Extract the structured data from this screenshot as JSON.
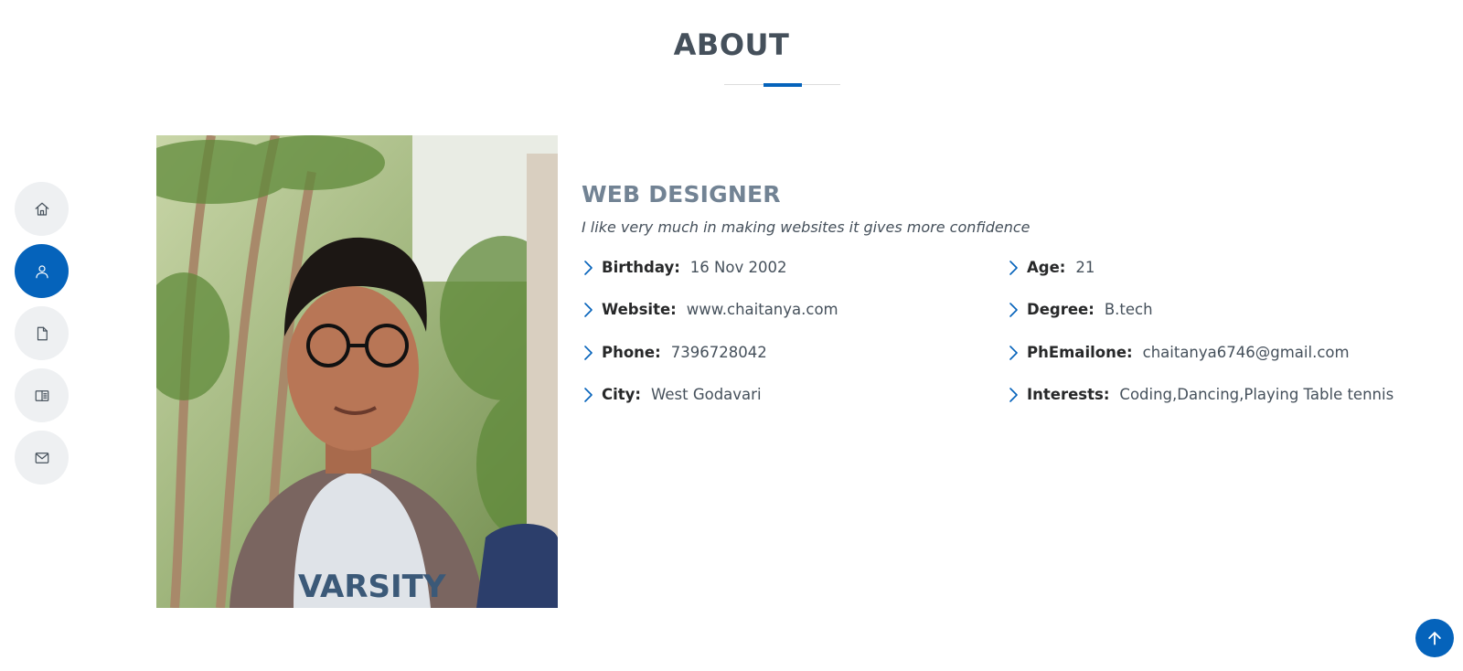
{
  "nav": {
    "items": [
      {
        "icon": "home-icon",
        "active": false
      },
      {
        "icon": "person-icon",
        "active": true
      },
      {
        "icon": "file-icon",
        "active": false
      },
      {
        "icon": "book-icon",
        "active": false
      },
      {
        "icon": "envelope-icon",
        "active": false
      }
    ]
  },
  "section": {
    "title": "ABOUT"
  },
  "about": {
    "role": "WEB DESIGNER",
    "tagline": "I like very much in making websites it gives more confidence",
    "facts_left": [
      {
        "label": "Birthday:",
        "value": "16 Nov 2002"
      },
      {
        "label": "Website:",
        "value": "www.chaitanya.com"
      },
      {
        "label": "Phone:",
        "value": "7396728042"
      },
      {
        "label": "City:",
        "value": "West Godavari"
      }
    ],
    "facts_right": [
      {
        "label": "Age:",
        "value": "21"
      },
      {
        "label": "Degree:",
        "value": "B.tech"
      },
      {
        "label": "PhEmailone:",
        "value": "chaitanya6746@gmail.com"
      },
      {
        "label": "Interests:",
        "value": "Coding,Dancing,Playing Table tennis"
      }
    ]
  },
  "photo": {
    "shirt_text": "VARSITY"
  },
  "colors": {
    "accent": "#0563bb",
    "heading": "#45505b",
    "role": "#728394"
  },
  "back_to_top": {
    "icon": "arrow-up-icon"
  }
}
